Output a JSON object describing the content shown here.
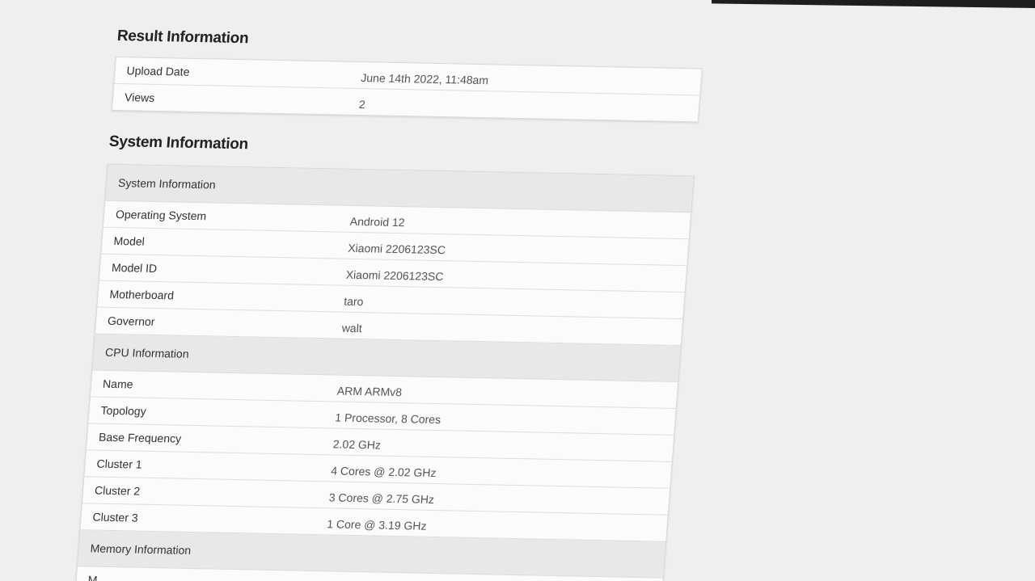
{
  "result": {
    "title": "Result Information",
    "rows": [
      {
        "name": "Upload Date",
        "value": "June 14th 2022, 11:48am"
      },
      {
        "name": "Views",
        "value": "2"
      }
    ]
  },
  "system": {
    "title": "System Information",
    "sections": [
      {
        "heading": "System Information",
        "rows": [
          {
            "name": "Operating System",
            "value": "Android 12"
          },
          {
            "name": "Model",
            "value": "Xiaomi 2206123SC"
          },
          {
            "name": "Model ID",
            "value": "Xiaomi 2206123SC"
          },
          {
            "name": "Motherboard",
            "value": "taro"
          },
          {
            "name": "Governor",
            "value": "walt"
          }
        ]
      },
      {
        "heading": "CPU Information",
        "rows": [
          {
            "name": "Name",
            "value": "ARM ARMv8"
          },
          {
            "name": "Topology",
            "value": "1 Processor, 8 Cores"
          },
          {
            "name": "Base Frequency",
            "value": "2.02 GHz"
          },
          {
            "name": "Cluster 1",
            "value": "4 Cores @ 2.02 GHz"
          },
          {
            "name": "Cluster 2",
            "value": "3 Cores @ 2.75 GHz"
          },
          {
            "name": "Cluster 3",
            "value": "1 Core @ 3.19 GHz"
          }
        ]
      },
      {
        "heading": "Memory Information",
        "rows": [
          {
            "name": "M",
            "value": ""
          }
        ]
      }
    ]
  }
}
